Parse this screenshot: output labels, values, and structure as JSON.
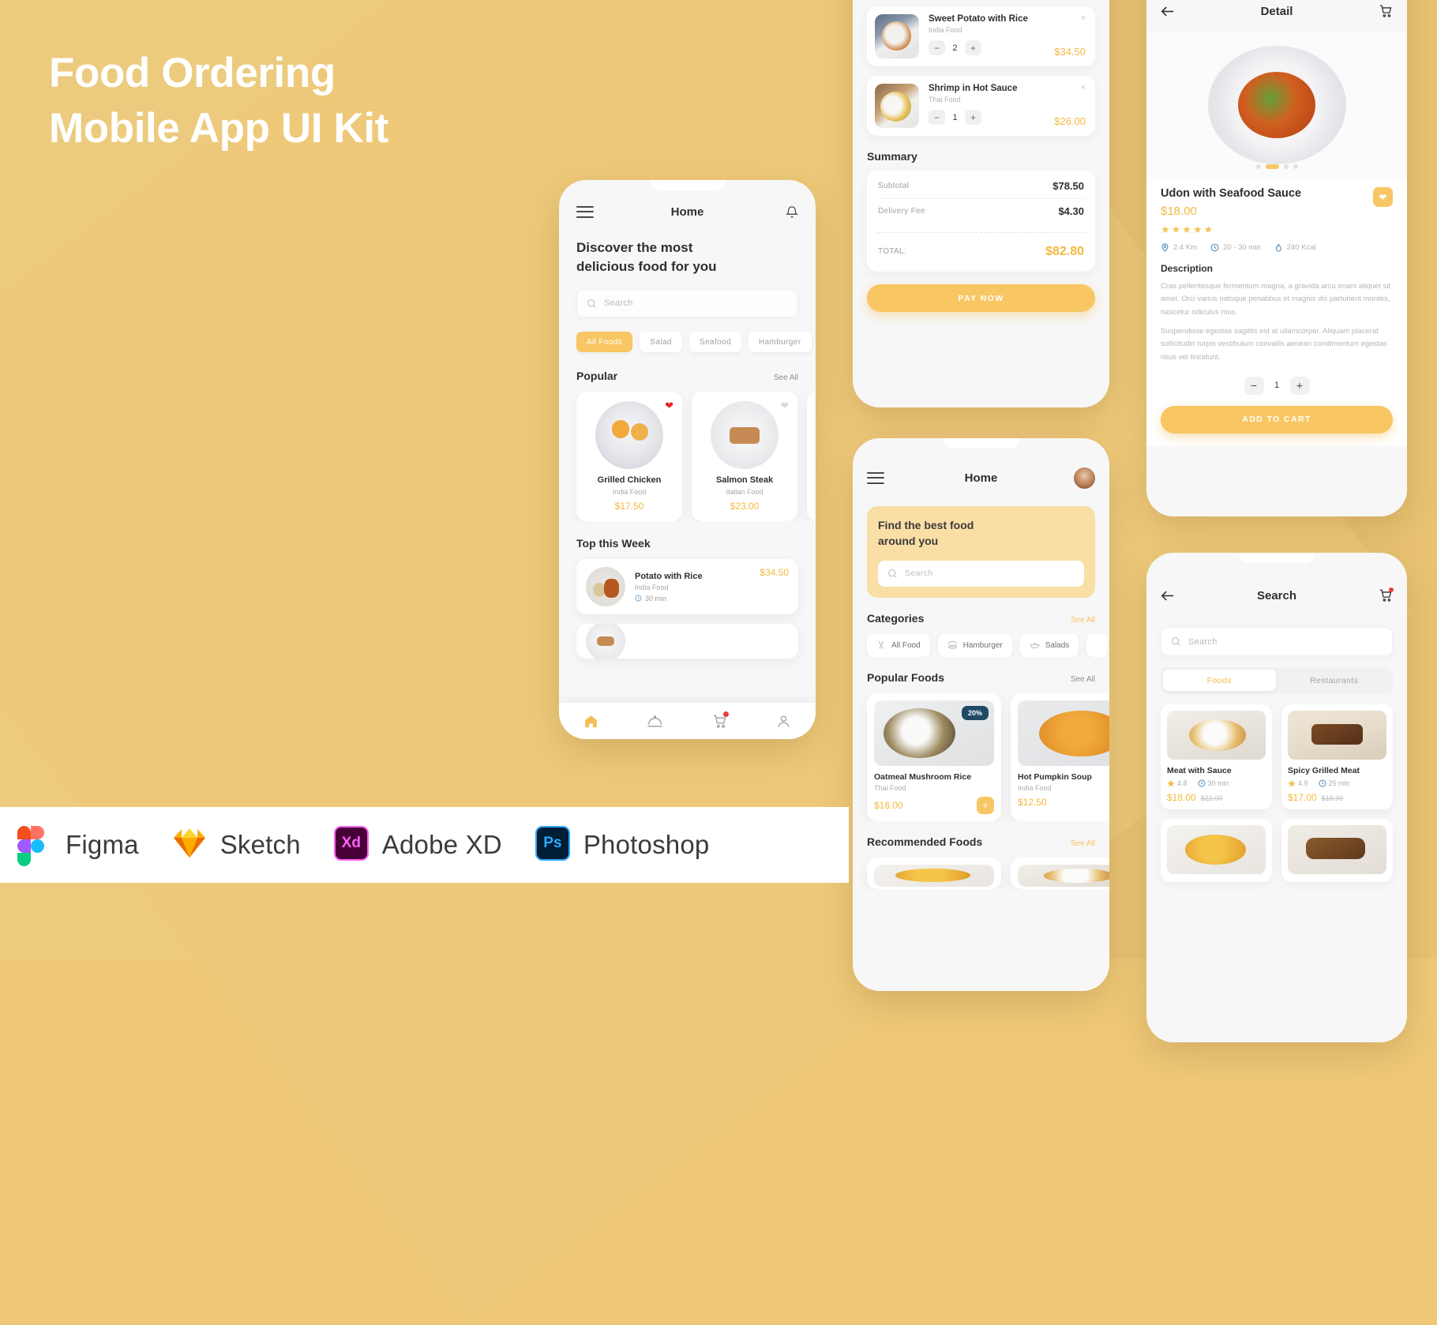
{
  "poster": {
    "title_line1": "Food Ordering",
    "title_line2": "Mobile App UI Kit",
    "bg_color": "#eccb7f",
    "accent_color": "#f8c662"
  },
  "software_bar": {
    "items": [
      {
        "name": "Figma",
        "icon": "figma-logo-icon"
      },
      {
        "name": "Sketch",
        "icon": "sketch-logo-icon"
      },
      {
        "name": "Adobe XD",
        "icon": "adobe-xd-logo-icon",
        "mark": "Xd"
      },
      {
        "name": "Photoshop",
        "icon": "photoshop-logo-icon",
        "mark": "Ps"
      }
    ]
  },
  "home_screen": {
    "title": "Home",
    "menu_icon": "hamburger-icon",
    "bell_icon": "bell-icon",
    "headline": "Discover the most\ndelicious food for you",
    "headline_l1": "Discover the most",
    "headline_l2": "delicious food for you",
    "search": {
      "placeholder": "Search",
      "icon": "search-icon"
    },
    "categories": [
      "All Foods",
      "Salad",
      "Seafood",
      "Hamburger"
    ],
    "active_category": "All Foods",
    "popular": {
      "title": "Popular",
      "see_all": "See All",
      "items": [
        {
          "name": "Grilled Chicken",
          "cuisine": "India Food",
          "price": "$17.50",
          "favorite": true
        },
        {
          "name": "Salmon Steak",
          "cuisine": "Italian Food",
          "price": "$23.00",
          "favorite": false
        }
      ]
    },
    "top_week": {
      "title": "Top this Week",
      "items": [
        {
          "name": "Potato with Rice",
          "cuisine": "India Food",
          "time": "30 min",
          "price": "$34.50"
        }
      ]
    },
    "nav": [
      {
        "name": "home",
        "icon": "home-icon",
        "active": true
      },
      {
        "name": "menu",
        "icon": "dish-cover-icon",
        "active": false
      },
      {
        "name": "cart",
        "icon": "cart-icon",
        "active": false,
        "badge": true
      },
      {
        "name": "profile",
        "icon": "person-icon",
        "active": false
      }
    ]
  },
  "cart_screen": {
    "items": [
      {
        "name": "Sweet Potato with Rice",
        "cuisine": "India Food",
        "qty": "2",
        "price": "$34.50"
      },
      {
        "name": "Shrimp in Hot Sauce",
        "cuisine": "Thai Food",
        "qty": "1",
        "price": "$26.00"
      }
    ],
    "summary_title": "Summary",
    "summary": [
      {
        "label": "Subtotal",
        "value": "$78.50"
      },
      {
        "label": "Delivery Fee",
        "value": "$4.30"
      }
    ],
    "total_label": "TOTAL:",
    "total_value": "$82.80",
    "pay_button": "PAY NOW",
    "minus": "−",
    "plus": "+",
    "close": "×"
  },
  "home2_screen": {
    "title": "Home",
    "menu_icon": "hamburger-icon",
    "avatar": "user-avatar",
    "promo_l1": "Find the best food",
    "promo_l2": "around you",
    "search": {
      "placeholder": "Search",
      "icon": "search-icon"
    },
    "categories_title": "Categories",
    "categories_see_all": "See All",
    "categories": [
      {
        "label": "All Food",
        "icon": "cutlery-icon"
      },
      {
        "label": "Hamburger",
        "icon": "burger-icon"
      },
      {
        "label": "Salads",
        "icon": "salad-bowl-icon"
      }
    ],
    "popular_title": "Popular Foods",
    "popular_see_all": "See All",
    "popular": [
      {
        "name": "Oatmeal Mushroom Rice",
        "cuisine": "Thai Food",
        "price": "$16.00",
        "badge": "20%"
      },
      {
        "name": "Hot Pumpkin Soup",
        "cuisine": "India Food",
        "price": "$12.50",
        "badge": ""
      }
    ],
    "recommended_title": "Recommended Foods",
    "recommended_see_all": "See All"
  },
  "detail_screen": {
    "title": "Detail",
    "back_icon": "arrow-left-icon",
    "cart_icon": "cart-icon",
    "dots_total": 4,
    "dots_active": 1,
    "food_name": "Udon with Seafood Sauce",
    "price": "$18.00",
    "rating_stars": 5,
    "favorite_icon": "heart-icon",
    "meta": [
      {
        "icon": "location-pin-icon",
        "label": "2.4 Km"
      },
      {
        "icon": "clock-icon",
        "label": "20 - 30 min"
      },
      {
        "icon": "fire-icon",
        "label": "240 Kcal"
      }
    ],
    "description_title": "Description",
    "description_p1": "Cras pellentesque fermentum magna, a gravida arcu enam aliquet sit amet. Orci varius natoque penatibus et magnis dis parturient montes, nascetur ridiculus mus.",
    "description_p2": "Suspendisse egestas sagittis est at ullamcorper. Aliquam placerat sollicitudin turpis vestibulum convallis aenean condimentum egestas risus vel tincidunt.",
    "qty": "1",
    "minus": "−",
    "plus": "+",
    "add_button": "ADD TO CART"
  },
  "search_screen": {
    "title": "Search",
    "back_icon": "arrow-left-icon",
    "cart_icon": "cart-icon",
    "search": {
      "placeholder": "Search",
      "icon": "search-icon"
    },
    "tabs": [
      {
        "label": "Foods",
        "active": true
      },
      {
        "label": "Restaurants",
        "active": false
      }
    ],
    "results": [
      {
        "name": "Meat with Sauce",
        "rating": "4.8",
        "time": "30 min",
        "price": "$18.00",
        "old_price": "$22.00"
      },
      {
        "name": "Spicy Grilled Meat",
        "rating": "4.9",
        "time": "25 min",
        "price": "$17.00",
        "old_price": "$18.99"
      }
    ]
  }
}
